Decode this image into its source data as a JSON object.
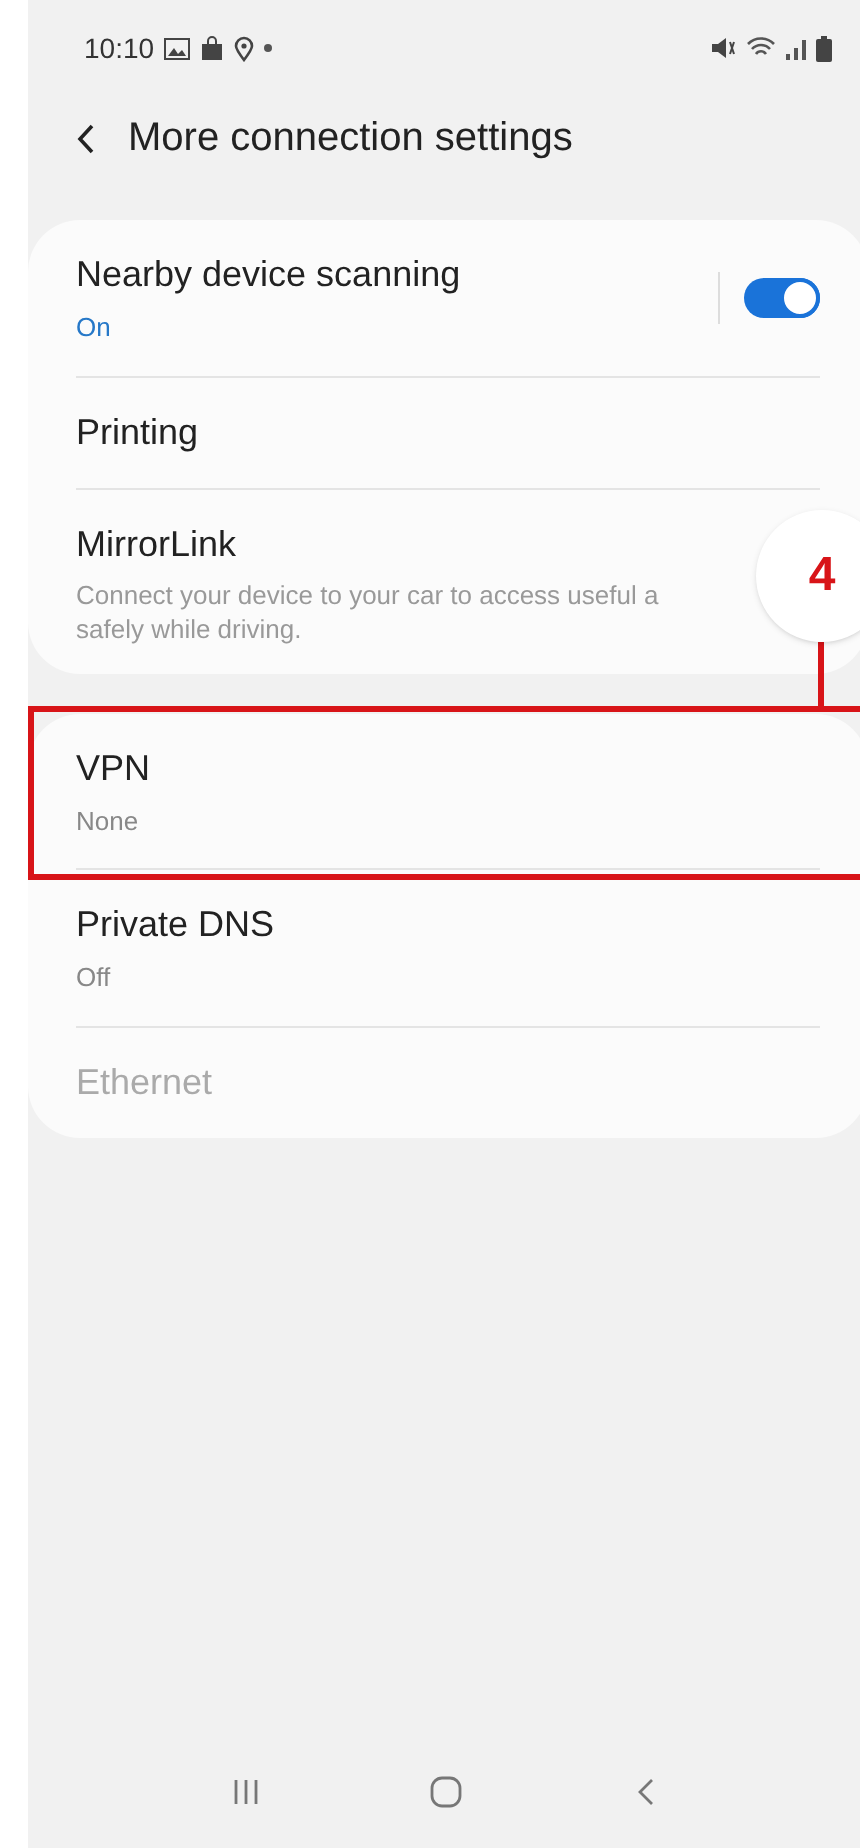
{
  "status_bar": {
    "time": "10:10"
  },
  "header": {
    "title": "More connection settings"
  },
  "sections": [
    {
      "items": [
        {
          "kind": "switch",
          "title": "Nearby device scanning",
          "subtitle": "On",
          "on": true,
          "disabled": false,
          "highlighted": false
        },
        {
          "kind": "plain",
          "title": "Printing",
          "disabled": false,
          "highlighted": false
        },
        {
          "kind": "plain",
          "title": "MirrorLink",
          "description_lines": [
            "Connect your device to your car to access useful a",
            "safely while driving."
          ],
          "disabled": false,
          "highlighted": false
        }
      ]
    },
    {
      "items": [
        {
          "kind": "plain",
          "title": "VPN",
          "subtitle": "None",
          "disabled": false,
          "highlighted": true
        },
        {
          "kind": "plain",
          "title": "Private DNS",
          "subtitle": "Off",
          "disabled": false,
          "highlighted": false
        },
        {
          "kind": "plain",
          "title": "Ethernet",
          "disabled": true,
          "highlighted": false
        }
      ]
    }
  ],
  "annotation": {
    "label": "4"
  }
}
